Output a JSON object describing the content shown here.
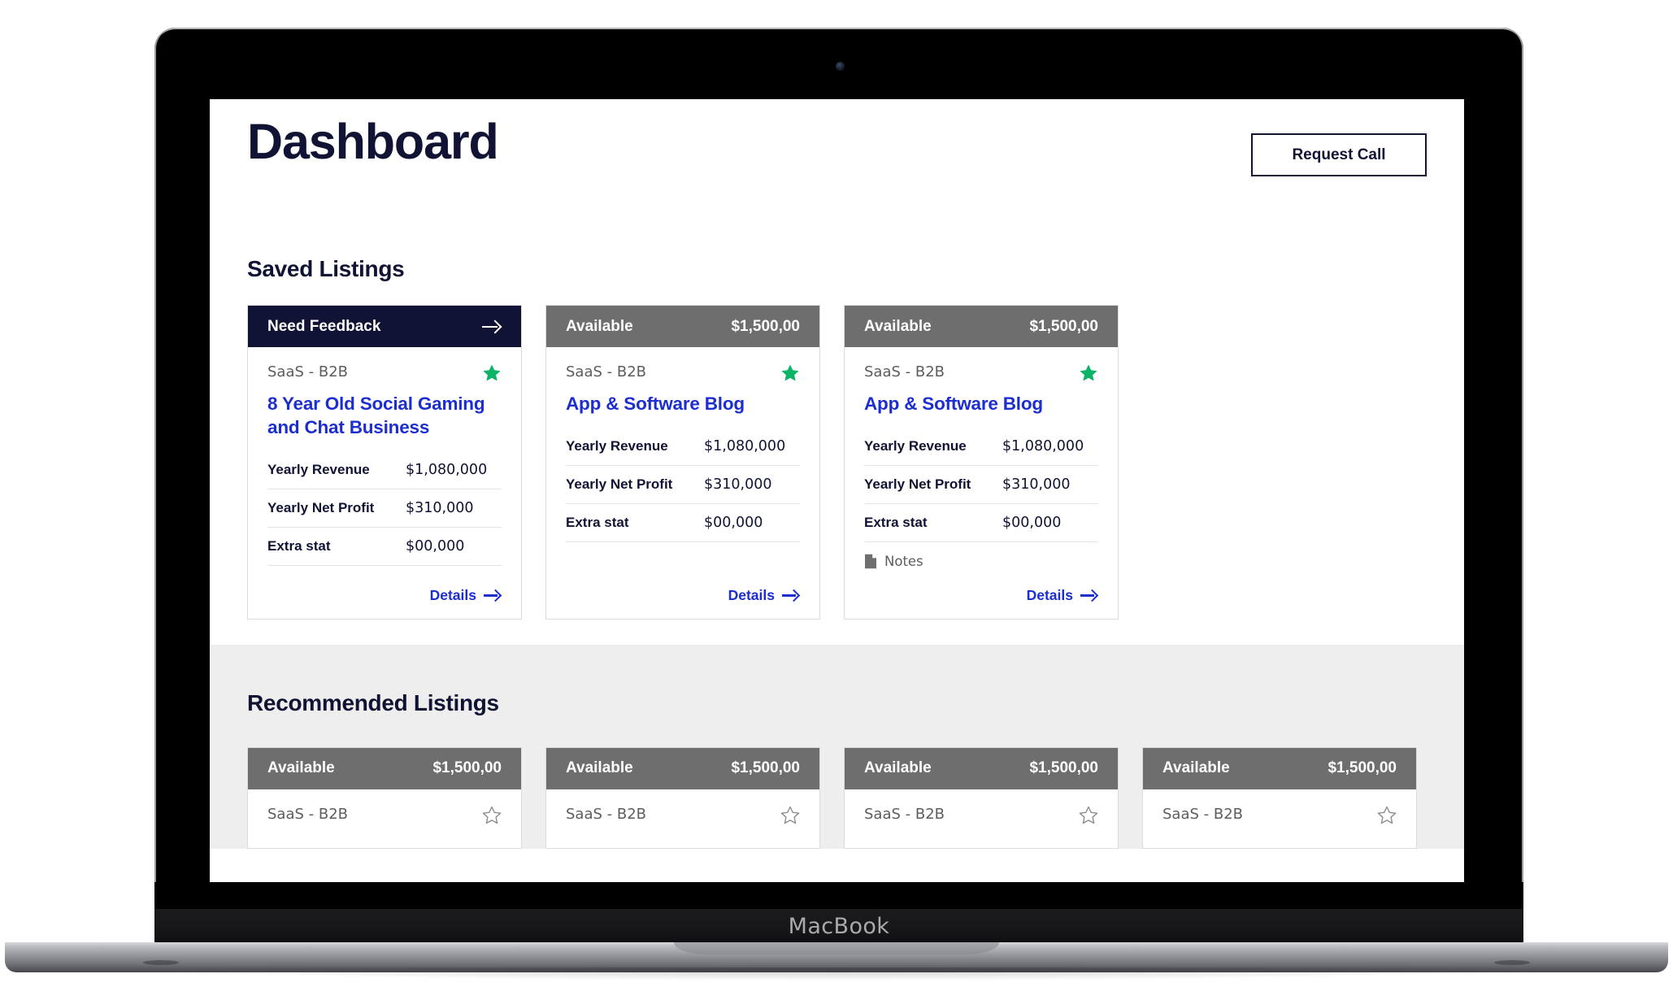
{
  "device": {
    "brand_label": "MacBook",
    "camera_icon": "camera-dot-icon"
  },
  "header": {
    "title": "Dashboard",
    "request_call_label": "Request Call"
  },
  "sections": {
    "saved": {
      "heading": "Saved Listings"
    },
    "recommended": {
      "heading": "Recommended Listings"
    }
  },
  "colors": {
    "navy": "#101334",
    "link_blue": "#1d2ed0",
    "star_green": "#0bb466",
    "header_gray": "#6e6e6e",
    "section_bg": "#efeeee",
    "card_border": "#dcdcdc",
    "muted_text": "#5d5d5d"
  },
  "labels": {
    "details": "Details",
    "notes": "Notes"
  },
  "saved_listings": [
    {
      "status": "Need Feedback",
      "status_style": "dark",
      "price": "",
      "has_head_arrow": true,
      "category": "SaaS - B2B",
      "starred": true,
      "title": "8 Year Old Social Gaming and Chat Business",
      "stats": [
        {
          "label": "Yearly Revenue",
          "value": "$1,080,000"
        },
        {
          "label": "Yearly Net Profit",
          "value": "$310,000"
        },
        {
          "label": "Extra stat",
          "value": "$00,000"
        }
      ],
      "notes": false,
      "details": "Details"
    },
    {
      "status": "Available",
      "status_style": "gray",
      "price": "$1,500,00",
      "has_head_arrow": false,
      "category": "SaaS - B2B",
      "starred": true,
      "title": "App & Software Blog",
      "stats": [
        {
          "label": "Yearly Revenue",
          "value": "$1,080,000"
        },
        {
          "label": "Yearly Net Profit",
          "value": "$310,000"
        },
        {
          "label": "Extra stat",
          "value": "$00,000"
        }
      ],
      "notes": false,
      "details": "Details"
    },
    {
      "status": "Available",
      "status_style": "gray",
      "price": "$1,500,00",
      "has_head_arrow": false,
      "category": "SaaS - B2B",
      "starred": true,
      "title": "App & Software Blog",
      "stats": [
        {
          "label": "Yearly Revenue",
          "value": "$1,080,000"
        },
        {
          "label": "Yearly Net Profit",
          "value": "$310,000"
        },
        {
          "label": "Extra stat",
          "value": "$00,000"
        }
      ],
      "notes": true,
      "notes_label": "Notes",
      "details": "Details"
    }
  ],
  "recommended_listings": [
    {
      "status": "Available",
      "price": "$1,500,00",
      "category": "SaaS - B2B",
      "starred": false
    },
    {
      "status": "Available",
      "price": "$1,500,00",
      "category": "SaaS - B2B",
      "starred": false
    },
    {
      "status": "Available",
      "price": "$1,500,00",
      "category": "SaaS - B2B",
      "starred": false
    },
    {
      "status": "Available",
      "price": "$1,500,00",
      "category": "SaaS - B2B",
      "starred": false
    }
  ]
}
